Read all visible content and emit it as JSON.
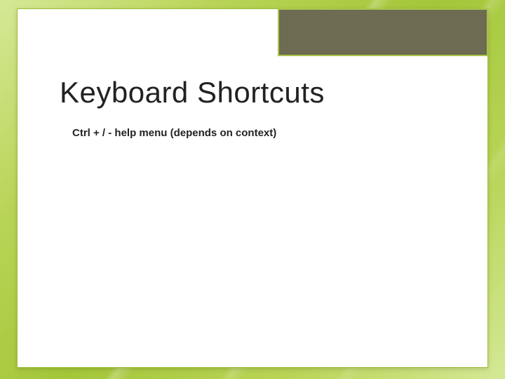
{
  "slide": {
    "title": "Keyboard Shortcuts",
    "body": "Ctrl + /  - help menu (depends on context)"
  },
  "theme": {
    "accent": "#a4c639",
    "corner": "#6d6b52",
    "border": "#a9c44b"
  }
}
